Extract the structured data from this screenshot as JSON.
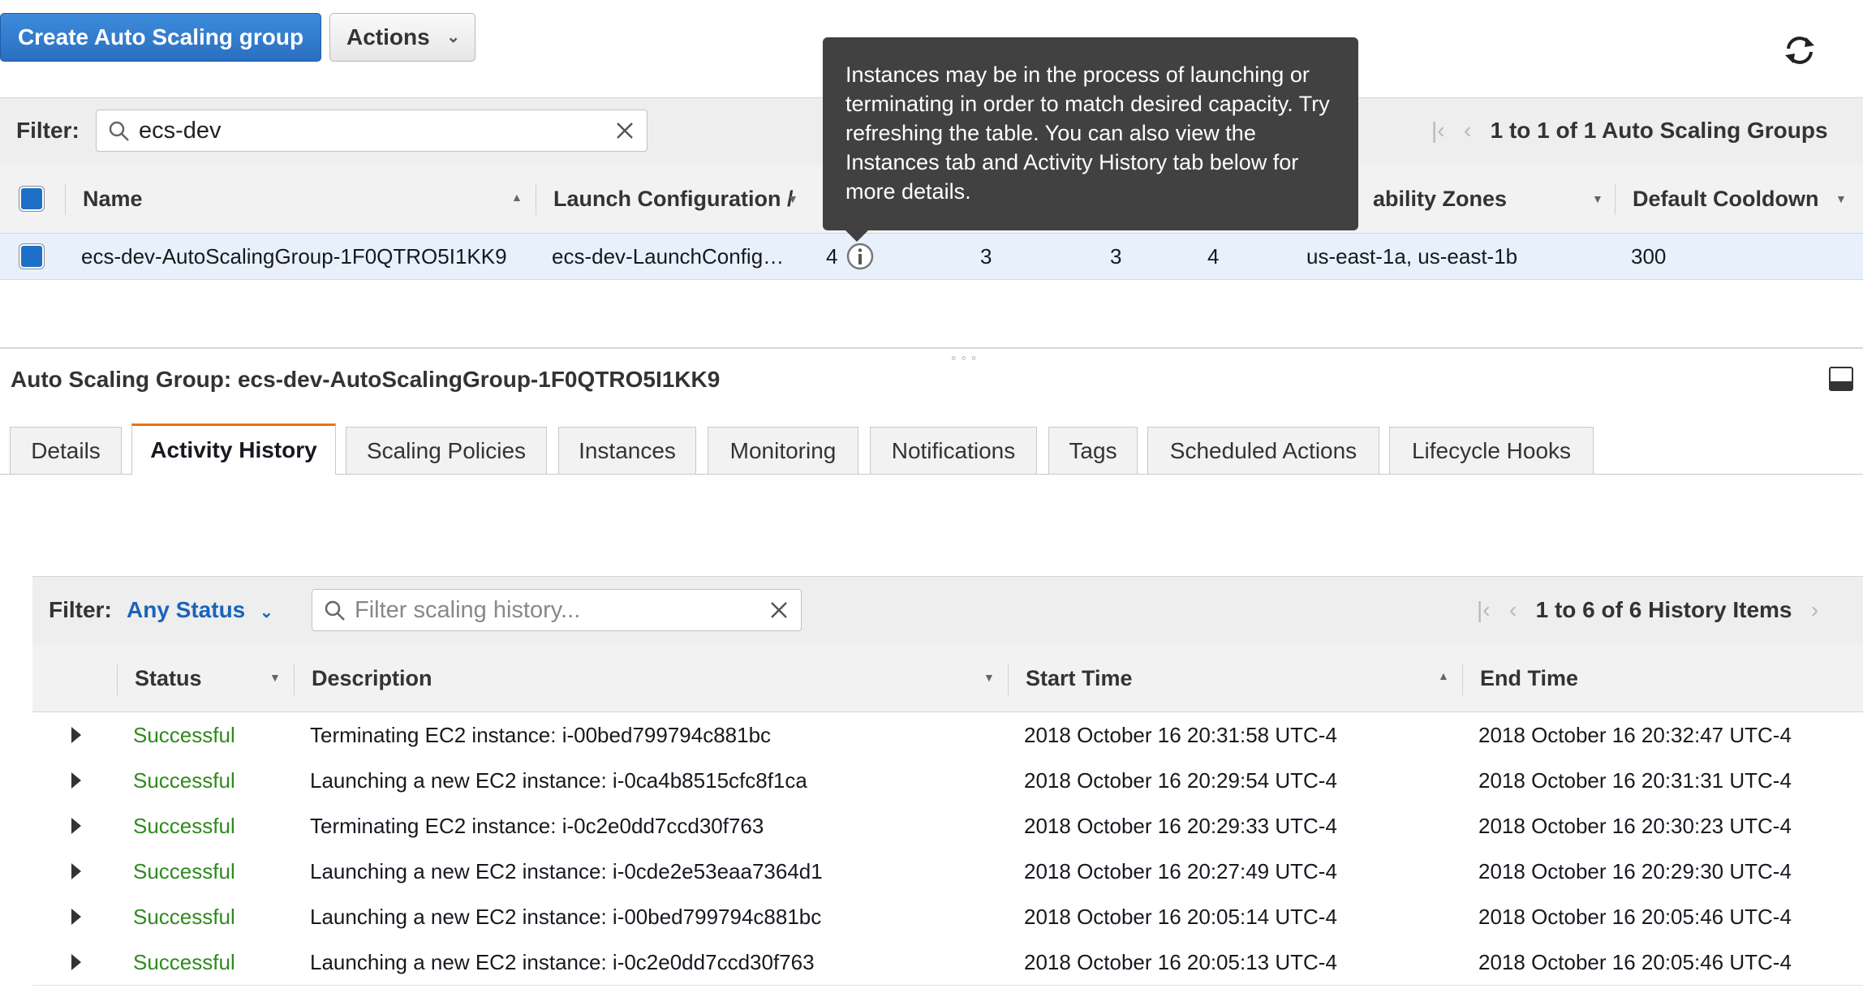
{
  "toolbar": {
    "create_label": "Create Auto Scaling group",
    "actions_label": "Actions"
  },
  "top_filter": {
    "label": "Filter:",
    "value": "ecs-dev",
    "pager_text": "1 to 1 of 1 Auto Scaling Groups"
  },
  "groups_table": {
    "headers": {
      "name": "Name",
      "launch_config": "Launch Configuration /",
      "zones": "ability Zones",
      "cooldown": "Default Cooldown"
    },
    "row": {
      "name": "ecs-dev-AutoScalingGroup-1F0QTRO5I1KK9",
      "launch_config": "ecs-dev-LaunchConfig…",
      "instances": "4",
      "desired": "3",
      "min": "3",
      "max": "4",
      "zones": "us-east-1a, us-east-1b",
      "cooldown": "300"
    }
  },
  "tooltip": {
    "text": "Instances may be in the process of launching or terminating in order to match desired capacity. Try refreshing the table. You can also view the Instances tab and Activity History tab below for more details."
  },
  "detail": {
    "title": "Auto Scaling Group: ecs-dev-AutoScalingGroup-1F0QTRO5I1KK9",
    "tabs": [
      {
        "label": "Details"
      },
      {
        "label": "Activity History",
        "active": true
      },
      {
        "label": "Scaling Policies"
      },
      {
        "label": "Instances"
      },
      {
        "label": "Monitoring"
      },
      {
        "label": "Notifications"
      },
      {
        "label": "Tags"
      },
      {
        "label": "Scheduled Actions"
      },
      {
        "label": "Lifecycle Hooks"
      }
    ]
  },
  "history": {
    "filter_label": "Filter:",
    "status_filter": "Any Status",
    "search_placeholder": "Filter scaling history...",
    "pager_text": "1 to 6 of 6 History Items",
    "headers": {
      "status": "Status",
      "description": "Description",
      "start": "Start Time",
      "end": "End Time"
    },
    "rows": [
      {
        "status": "Successful",
        "description": "Terminating EC2 instance: i-00bed799794c881bc",
        "start": "2018 October 16 20:31:58 UTC-4",
        "end": "2018 October 16 20:32:47 UTC-4"
      },
      {
        "status": "Successful",
        "description": "Launching a new EC2 instance: i-0ca4b8515cfc8f1ca",
        "start": "2018 October 16 20:29:54 UTC-4",
        "end": "2018 October 16 20:31:31 UTC-4"
      },
      {
        "status": "Successful",
        "description": "Terminating EC2 instance: i-0c2e0dd7ccd30f763",
        "start": "2018 October 16 20:29:33 UTC-4",
        "end": "2018 October 16 20:30:23 UTC-4"
      },
      {
        "status": "Successful",
        "description": "Launching a new EC2 instance: i-0cde2e53eaa7364d1",
        "start": "2018 October 16 20:27:49 UTC-4",
        "end": "2018 October 16 20:29:30 UTC-4"
      },
      {
        "status": "Successful",
        "description": "Launching a new EC2 instance: i-00bed799794c881bc",
        "start": "2018 October 16 20:05:14 UTC-4",
        "end": "2018 October 16 20:05:46 UTC-4"
      },
      {
        "status": "Successful",
        "description": "Launching a new EC2 instance: i-0c2e0dd7ccd30f763",
        "start": "2018 October 16 20:05:13 UTC-4",
        "end": "2018 October 16 20:05:46 UTC-4"
      }
    ]
  },
  "colors": {
    "primary": "#2a6fc0",
    "success": "#2f8a1e",
    "tab_accent": "#ec7211",
    "tooltip_bg": "#414141",
    "selected_row": "#e8f1fb"
  }
}
